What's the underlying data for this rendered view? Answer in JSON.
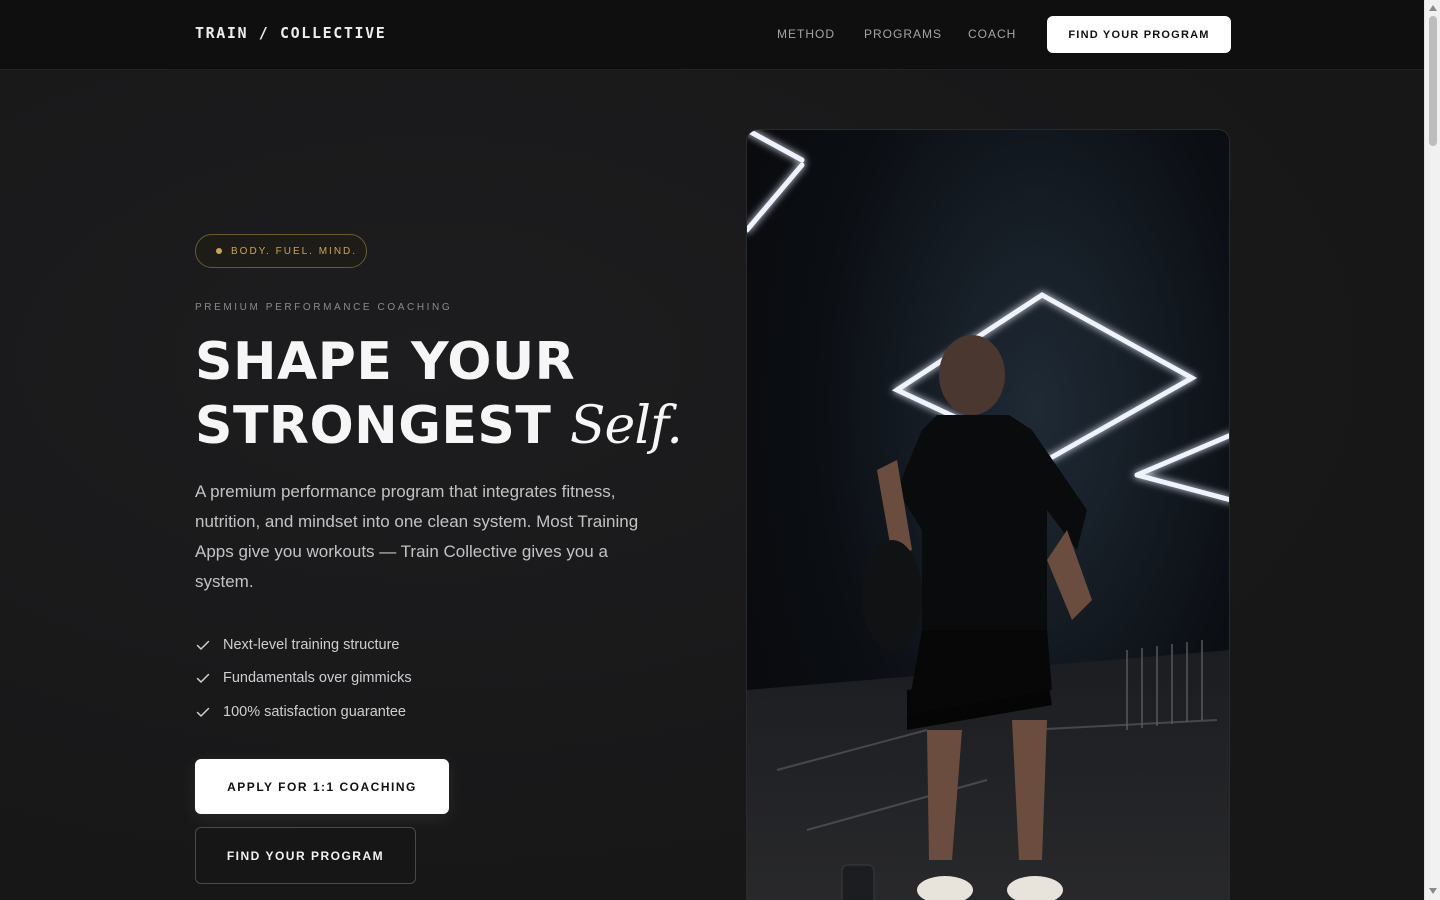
{
  "header": {
    "logo": "TRAIN / COLLECTIVE",
    "nav": [
      "METHOD",
      "PROGRAMS",
      "COACH"
    ],
    "cta_label": "FIND YOUR PROGRAM"
  },
  "hero": {
    "badge": "BODY. FUEL. MIND.",
    "eyebrow": "PREMIUM PERFORMANCE COACHING",
    "headline_line1": "SHAPE YOUR",
    "headline_line2": "STRONGEST",
    "headline_accent": "Self.",
    "lead": "A premium performance program that integrates fitness, nutrition, and mindset into one clean system. Most Training Apps give you workouts — Train Collective gives you a system.",
    "features": [
      "Next-level training structure",
      "Fundamentals over gimmicks",
      "100% satisfaction guarantee"
    ],
    "primary_cta": "APPLY FOR 1:1 COACHING",
    "secondary_cta": "FIND YOUR PROGRAM"
  },
  "theme": {
    "background": "#181819",
    "accent_gold": "#c9a451",
    "text_primary": "#f6f6f6"
  },
  "icons": {
    "feature": "check-icon",
    "badge": "dot-icon"
  }
}
